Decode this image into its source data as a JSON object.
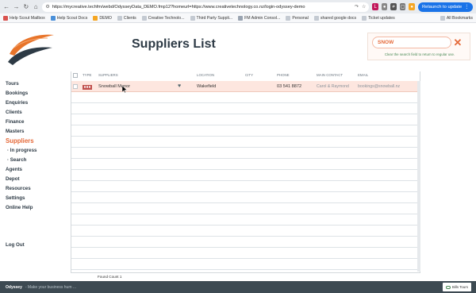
{
  "browser": {
    "url": "https://mycreative.techfm/webd/OdysseyData_DEMO.fmp12?homeurl=https://www.creativetechnology.co.nz/login-odyssey-demo",
    "relaunch_label": "Relaunch to update",
    "bookmarks": [
      {
        "label": "Help Scout Mailbox"
      },
      {
        "label": "Help Scout Docs"
      },
      {
        "label": "DEMO"
      },
      {
        "label": "Clients"
      },
      {
        "label": "Creative Technolo..."
      },
      {
        "label": "Third Party Suppli..."
      },
      {
        "label": "FM Admin Consol..."
      },
      {
        "label": "Personal"
      },
      {
        "label": "shared google docs"
      },
      {
        "label": "Ticket updates"
      }
    ],
    "all_bookmarks_label": "All Bookmarks"
  },
  "header": {
    "title": "Suppliers List"
  },
  "search": {
    "value": "SNOW",
    "hint": "Clear the search field to return to regular use."
  },
  "sidebar": {
    "items": [
      {
        "label": "Tours"
      },
      {
        "label": "Bookings"
      },
      {
        "label": "Enquiries"
      },
      {
        "label": "Clients"
      },
      {
        "label": "Finance"
      },
      {
        "label": "Masters"
      },
      {
        "label": "Suppliers"
      },
      {
        "label": "· In progress"
      },
      {
        "label": "· Search"
      },
      {
        "label": "Agents"
      },
      {
        "label": "Depot"
      },
      {
        "label": "Resources"
      },
      {
        "label": "Settings"
      },
      {
        "label": "Online Help"
      }
    ],
    "logout_label": "Log Out"
  },
  "table": {
    "columns": [
      "TYPE",
      "SUPPLIERS",
      "LOCATION",
      "CITY",
      "PHONE",
      "MAIN CONTACT",
      "EMAIL"
    ],
    "rows": [
      {
        "supplier": "Snowball Manor",
        "location": "Wakefield",
        "city": "",
        "phone": "03 541 8872",
        "contact": "Carol & Raymond",
        "email": "bookings@snowball.nz"
      }
    ],
    "found_count_label": "Found Count 1"
  },
  "footer": {
    "brand": "Odyssey",
    "tagline": "- Make your business hum ...",
    "badge_label": "Bills Tours"
  },
  "colors": {
    "accent": "#e56a3a",
    "selected_row": "#fde6df",
    "footer_bg": "#3d4a52",
    "title": "#2d3a45"
  }
}
